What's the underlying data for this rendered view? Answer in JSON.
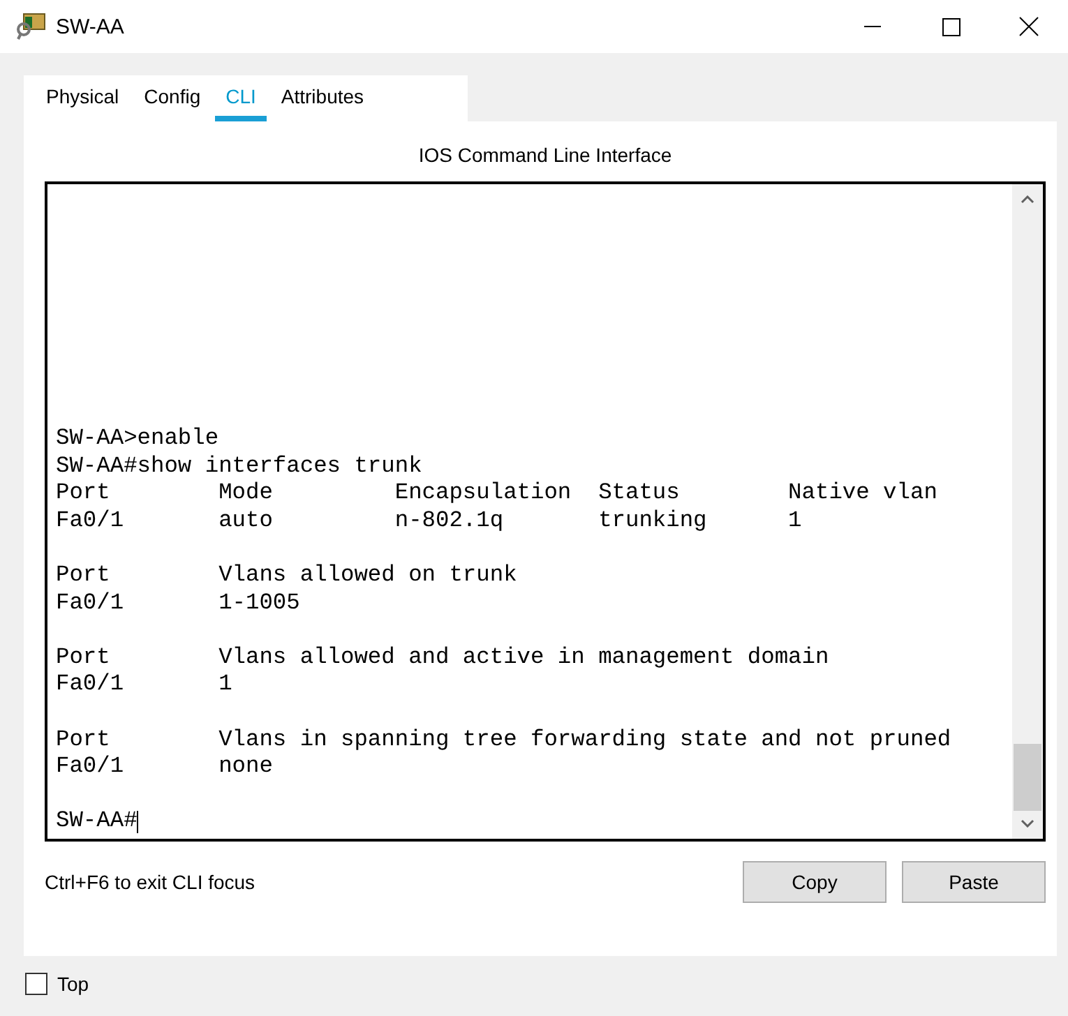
{
  "window": {
    "title": "SW-AA"
  },
  "tabs": [
    {
      "label": "Physical",
      "selected": false
    },
    {
      "label": "Config",
      "selected": false
    },
    {
      "label": "CLI",
      "selected": true
    },
    {
      "label": "Attributes",
      "selected": false
    }
  ],
  "cli": {
    "heading": "IOS Command Line Interface",
    "blocks": [
      [
        "SW-AA>enable",
        "SW-AA#show interfaces trunk",
        "Port        Mode         Encapsulation  Status        Native vlan",
        "Fa0/1       auto         n-802.1q       trunking      1"
      ],
      [
        "Port        Vlans allowed on trunk",
        "Fa0/1       1-1005"
      ],
      [
        "Port        Vlans allowed and active in management domain",
        "Fa0/1       1"
      ],
      [
        "Port        Vlans in spanning tree forwarding state and not pruned",
        "Fa0/1       none"
      ],
      [
        "SW-AA#"
      ]
    ],
    "hint": "Ctrl+F6 to exit CLI focus",
    "buttons": [
      "Copy",
      "Paste"
    ]
  },
  "top_checkbox": {
    "label": "Top",
    "checked": false
  }
}
